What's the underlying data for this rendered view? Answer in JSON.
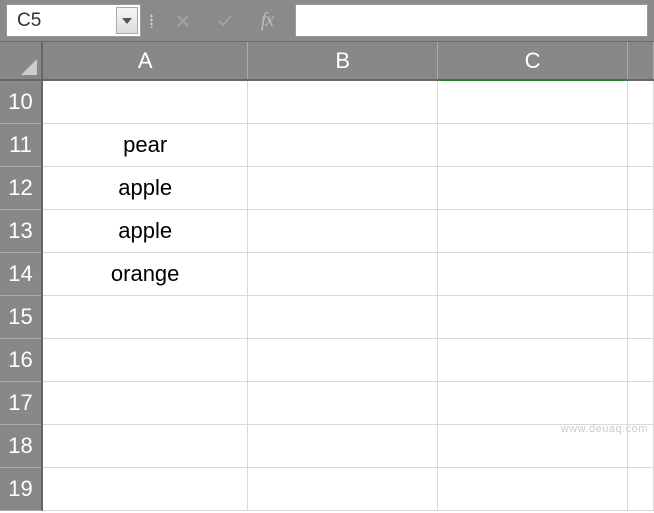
{
  "formula_bar": {
    "name_box": "C5",
    "formula_value": "",
    "fx_label": "fx"
  },
  "columns": [
    "A",
    "B",
    "C"
  ],
  "row_start": 10,
  "rows": [
    {
      "num": "10",
      "cells": [
        "",
        "",
        ""
      ]
    },
    {
      "num": "11",
      "cells": [
        "pear",
        "",
        ""
      ]
    },
    {
      "num": "12",
      "cells": [
        "apple",
        "",
        ""
      ]
    },
    {
      "num": "13",
      "cells": [
        "apple",
        "",
        ""
      ]
    },
    {
      "num": "14",
      "cells": [
        "orange",
        "",
        ""
      ]
    },
    {
      "num": "15",
      "cells": [
        "",
        "",
        ""
      ]
    },
    {
      "num": "16",
      "cells": [
        "",
        "",
        ""
      ]
    },
    {
      "num": "17",
      "cells": [
        "",
        "",
        ""
      ]
    },
    {
      "num": "18",
      "cells": [
        "",
        "",
        ""
      ]
    },
    {
      "num": "19",
      "cells": [
        "",
        "",
        ""
      ]
    }
  ],
  "selected_cell": "C5",
  "watermark": "www.deuaq.com"
}
